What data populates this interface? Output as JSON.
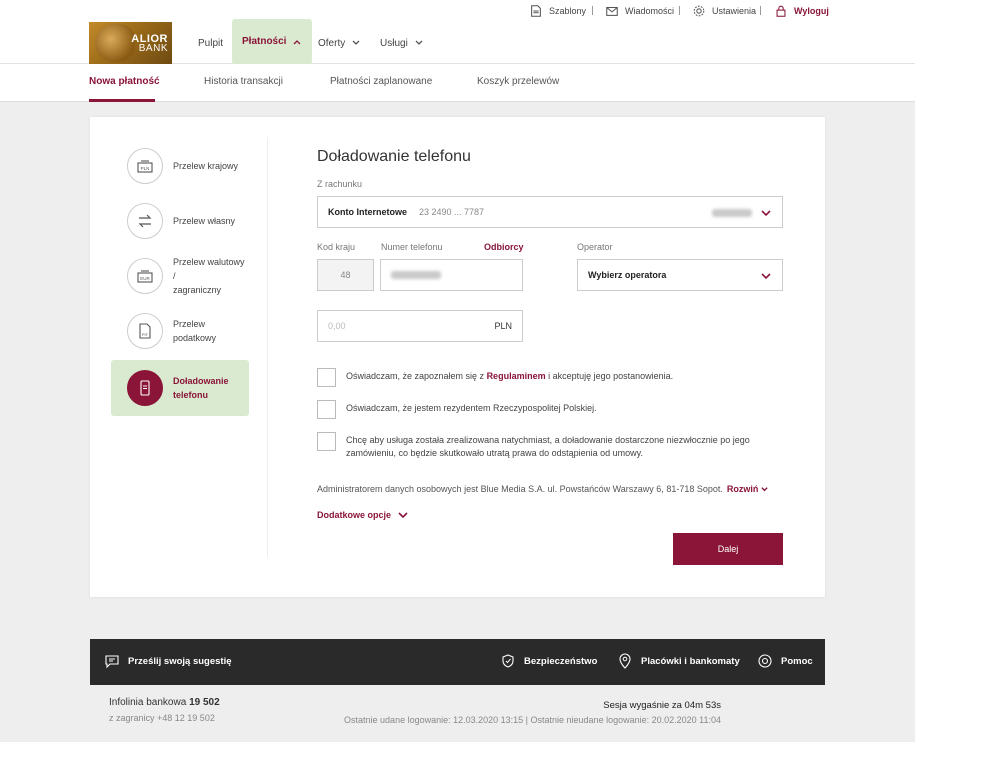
{
  "utility": {
    "templates": "Szablony",
    "messages": "Wiadomości",
    "settings": "Ustawienia",
    "logout": "Wyloguj"
  },
  "brand": {
    "line1": "ALIOR",
    "line2": "BANK"
  },
  "nav": {
    "items": [
      {
        "label": "Pulpit"
      },
      {
        "label": "Płatności"
      },
      {
        "label": "Oferty"
      },
      {
        "label": "Usługi"
      }
    ]
  },
  "subnav": {
    "items": [
      {
        "label": "Nowa płatność"
      },
      {
        "label": "Historia transakcji"
      },
      {
        "label": "Płatności zaplanowane"
      },
      {
        "label": "Koszyk przelewów"
      }
    ]
  },
  "payment_types": [
    {
      "label": "Przelew krajowy",
      "icon": "pln-transfer-icon",
      "badge": "PLN"
    },
    {
      "label": "Przelew własny",
      "icon": "own-transfer-icon"
    },
    {
      "label_line1": "Przelew walutowy /",
      "label_line2": "zagraniczny",
      "icon": "eur-transfer-icon",
      "badge": "EUR"
    },
    {
      "label": "Przelew podatkowy",
      "icon": "tax-transfer-icon",
      "badge": "PIT"
    },
    {
      "label_line1": "Doładowanie",
      "label_line2": "telefonu",
      "icon": "phone-topup-icon"
    }
  ],
  "form": {
    "title": "Doładowanie telefonu",
    "from_account_label": "Z rachunku",
    "account_name": "Konto Internetowe",
    "account_number": "23 2490 ... 7787",
    "country_code_label": "Kod kraju",
    "country_code": "48",
    "phone_label": "Numer telefonu",
    "recipients_link": "Odbiorcy",
    "operator_label": "Operator",
    "operator_value": "Wybierz operatora",
    "amount_placeholder": "0,00",
    "currency": "PLN",
    "consent1_a": "Oświadczam, że zapoznałem się z ",
    "consent1_link": "Regulaminem",
    "consent1_b": " i akceptuję jego postanowienia.",
    "consent2": "Oświadczam, że jestem rezydentem Rzeczypospolitej Polskiej.",
    "consent3": "Chcę aby usługa została zrealizowana natychmiast, a doładowanie dostarczone niezwłocznie po jego zamówieniu, co będzie skutkowało utratą prawa do odstąpienia od umowy.",
    "admin_text": "Administratorem danych osobowych jest Blue Media S.A. ul. Powstańców Warszawy 6, 81-718 Sopot.",
    "expand": "Rozwiń",
    "extra_options": "Dodatkowe opcje",
    "next_button": "Dalej"
  },
  "footer": {
    "suggestion": "Prześlij swoją sugestię",
    "security": "Bezpieczeństwo",
    "branches": "Placówki i bankomaty",
    "help": "Pomoc",
    "hotline_label": "Infolinia bankowa",
    "hotline_number": "19 502",
    "abroad": "z zagranicy +48 12 19 502",
    "session": "Sesja wygaśnie za 04m 53s",
    "last_login": "Ostatnie udane logowanie: 12.03.2020 13:15 | Ostatnie nieudane logowanie: 20.02.2020 11:04"
  },
  "colors": {
    "accent": "#8a1538",
    "active_bg": "#d9ead0",
    "footer_bg": "#2a2a2a"
  }
}
